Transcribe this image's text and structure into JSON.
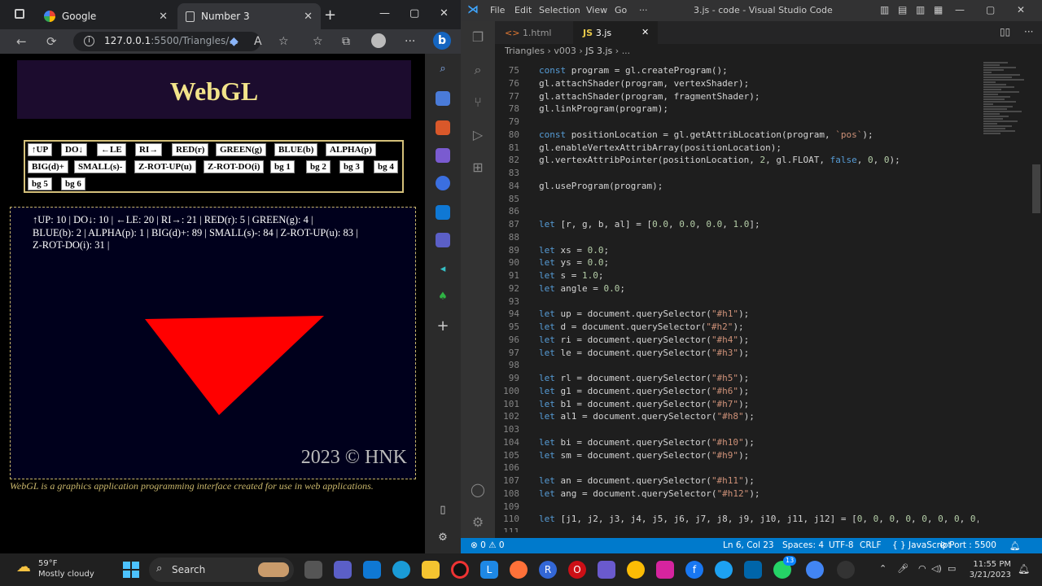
{
  "browser": {
    "tabs": [
      {
        "title": "Google"
      },
      {
        "title": "Number 3"
      }
    ],
    "url_host": "127.0.0.1",
    "url_rest": ":5500/Triangles/...",
    "page": {
      "banner_title": "WebGL",
      "buttons": [
        "↑UP",
        "DO↓",
        "←LE",
        "RI→",
        "RED(r)",
        "GREEN(g)",
        "BLUE(b)",
        "ALPHA(p)",
        "BIG(d)+",
        "SMALL(s)-",
        "Z-ROT-UP(u)",
        "Z-ROT-DO(i)",
        "bg 1",
        "bg 2",
        "bg 3",
        "bg 4",
        "bg 5",
        "bg 6"
      ],
      "status_lines": [
        "↑UP:  10 |  DO↓:  10 |  ←LE:  20 |  RI→:  21 |  RED(r):  5 |  GREEN(g):  4 |",
        "BLUE(b):  2 |  ALPHA(p):  1 |  BIG(d)+:  89 |  SMALL(s)-:  84 |  Z-ROT-UP(u):  83 |",
        "Z-ROT-DO(i):  31 |"
      ],
      "triangle_color": "#ff0000",
      "copyright": "2023 © HNK",
      "footer": "WebGL is a graphics application programming interface created for use in web applications."
    }
  },
  "vscode": {
    "menu": [
      "File",
      "Edit",
      "Selection",
      "View",
      "Go",
      "···"
    ],
    "window_title": "3.js - code - Visual Studio Code",
    "tabs": [
      {
        "label": "1.html"
      },
      {
        "label": "3.js"
      }
    ],
    "breadcrumb": [
      "Triangles",
      "v003",
      "JS 3.js",
      "..."
    ],
    "status": {
      "problems": "⊗ 0 ⚠ 0",
      "position": "Ln 6, Col 23",
      "spaces": "Spaces: 4",
      "encoding": "UTF-8",
      "eol": "CRLF",
      "language": "{ } JavaScript",
      "port": "⊘ Port : 5500"
    },
    "code_lines": [
      {
        "n": "75",
        "t": "const program = gl.createProgram();"
      },
      {
        "n": "76",
        "t": "gl.attachShader(program, vertexShader);"
      },
      {
        "n": "77",
        "t": "gl.attachShader(program, fragmentShader);"
      },
      {
        "n": "78",
        "t": "gl.linkProgram(program);"
      },
      {
        "n": "79",
        "t": ""
      },
      {
        "n": "80",
        "t": "const positionLocation = gl.getAttribLocation(program, `pos`);"
      },
      {
        "n": "81",
        "t": "gl.enableVertexAttribArray(positionLocation);"
      },
      {
        "n": "82",
        "t": "gl.vertexAttribPointer(positionLocation, 2, gl.FLOAT, false, 0, 0);"
      },
      {
        "n": "83",
        "t": ""
      },
      {
        "n": "84",
        "t": "gl.useProgram(program);"
      },
      {
        "n": "85",
        "t": ""
      },
      {
        "n": "86",
        "t": ""
      },
      {
        "n": "87",
        "t": "let [r, g, b, al] = [0.0, 0.0, 0.0, 1.0];"
      },
      {
        "n": "88",
        "t": ""
      },
      {
        "n": "89",
        "t": "let xs = 0.0;"
      },
      {
        "n": "90",
        "t": "let ys = 0.0;"
      },
      {
        "n": "91",
        "t": "let s = 1.0;"
      },
      {
        "n": "92",
        "t": "let angle = 0.0;"
      },
      {
        "n": "93",
        "t": ""
      },
      {
        "n": "94",
        "t": "let up = document.querySelector(\"#h1\");"
      },
      {
        "n": "95",
        "t": "let d = document.querySelector(\"#h2\");"
      },
      {
        "n": "96",
        "t": "let ri = document.querySelector(\"#h4\");"
      },
      {
        "n": "97",
        "t": "let le = document.querySelector(\"#h3\");"
      },
      {
        "n": "98",
        "t": ""
      },
      {
        "n": "99",
        "t": "let rl = document.querySelector(\"#h5\");"
      },
      {
        "n": "100",
        "t": "let g1 = document.querySelector(\"#h6\");"
      },
      {
        "n": "101",
        "t": "let b1 = document.querySelector(\"#h7\");"
      },
      {
        "n": "102",
        "t": "let al1 = document.querySelector(\"#h8\");"
      },
      {
        "n": "103",
        "t": ""
      },
      {
        "n": "104",
        "t": "let bi = document.querySelector(\"#h10\");"
      },
      {
        "n": "105",
        "t": "let sm = document.querySelector(\"#h9\");"
      },
      {
        "n": "106",
        "t": ""
      },
      {
        "n": "107",
        "t": "let an = document.querySelector(\"#h11\");"
      },
      {
        "n": "108",
        "t": "let ang = document.querySelector(\"#h12\");"
      },
      {
        "n": "109",
        "t": ""
      },
      {
        "n": "110",
        "t": "let [j1, j2, j3, j4, j5, j6, j7, j8, j9, j10, j11, j12] = [0, 0, 0, 0, 0, 0, 0, 0,"
      },
      {
        "n": "111",
        "t": ""
      }
    ]
  },
  "taskbar": {
    "weather_temp": "59°F",
    "weather_desc": "Mostly cloudy",
    "search_label": "Search",
    "whatsapp_badge": "13",
    "time": "11:55 PM",
    "date": "3/21/2023"
  }
}
